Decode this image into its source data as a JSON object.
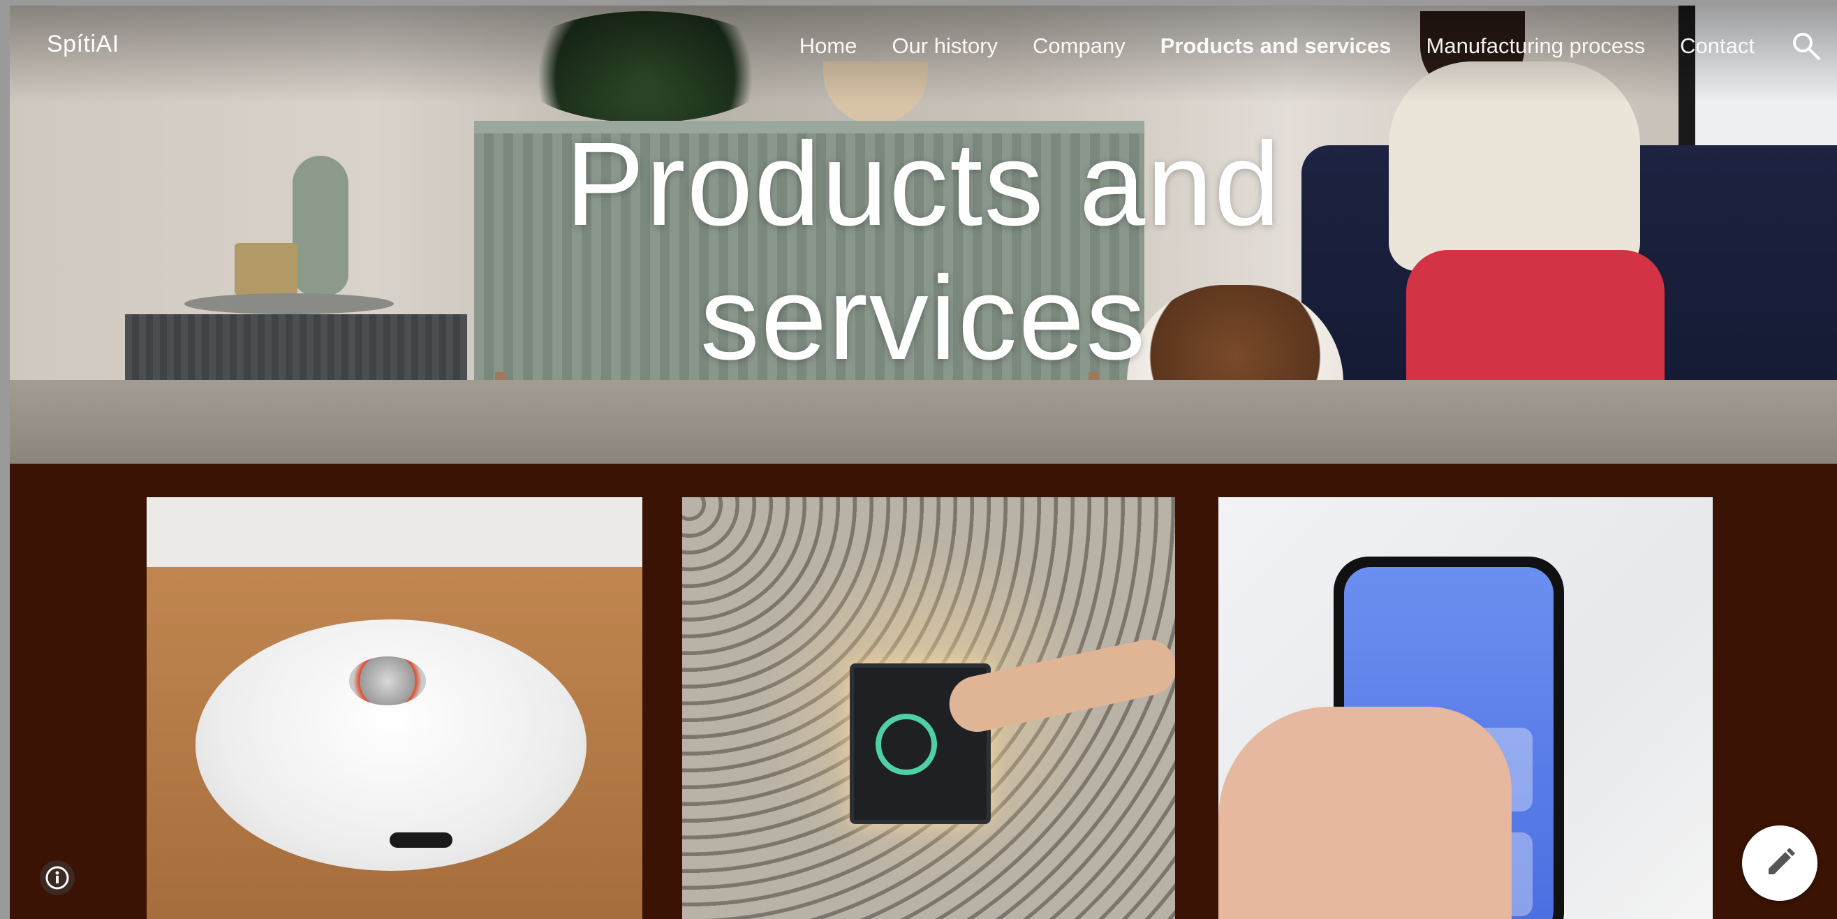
{
  "site": {
    "title": "SpítiAI"
  },
  "nav": {
    "items": [
      {
        "label": "Home"
      },
      {
        "label": "Our history"
      },
      {
        "label": "Company"
      },
      {
        "label": "Products and services",
        "active": true
      },
      {
        "label": "Manufacturing process"
      },
      {
        "label": "Contact"
      }
    ],
    "search_icon": "search-icon"
  },
  "hero": {
    "title_line1": "Products and",
    "title_line2": "services"
  },
  "images": {
    "tile1": "robot-vacuum-photo",
    "tile2": "wall-touch-panel-photo",
    "tile3": "smartphone-app-photo"
  },
  "floating": {
    "info_icon": "info-icon",
    "edit_icon": "pencil-icon"
  },
  "colors": {
    "content_bg": "#3a1304",
    "nav_text": "#ffffff",
    "page_border": "#9a9a9a"
  }
}
